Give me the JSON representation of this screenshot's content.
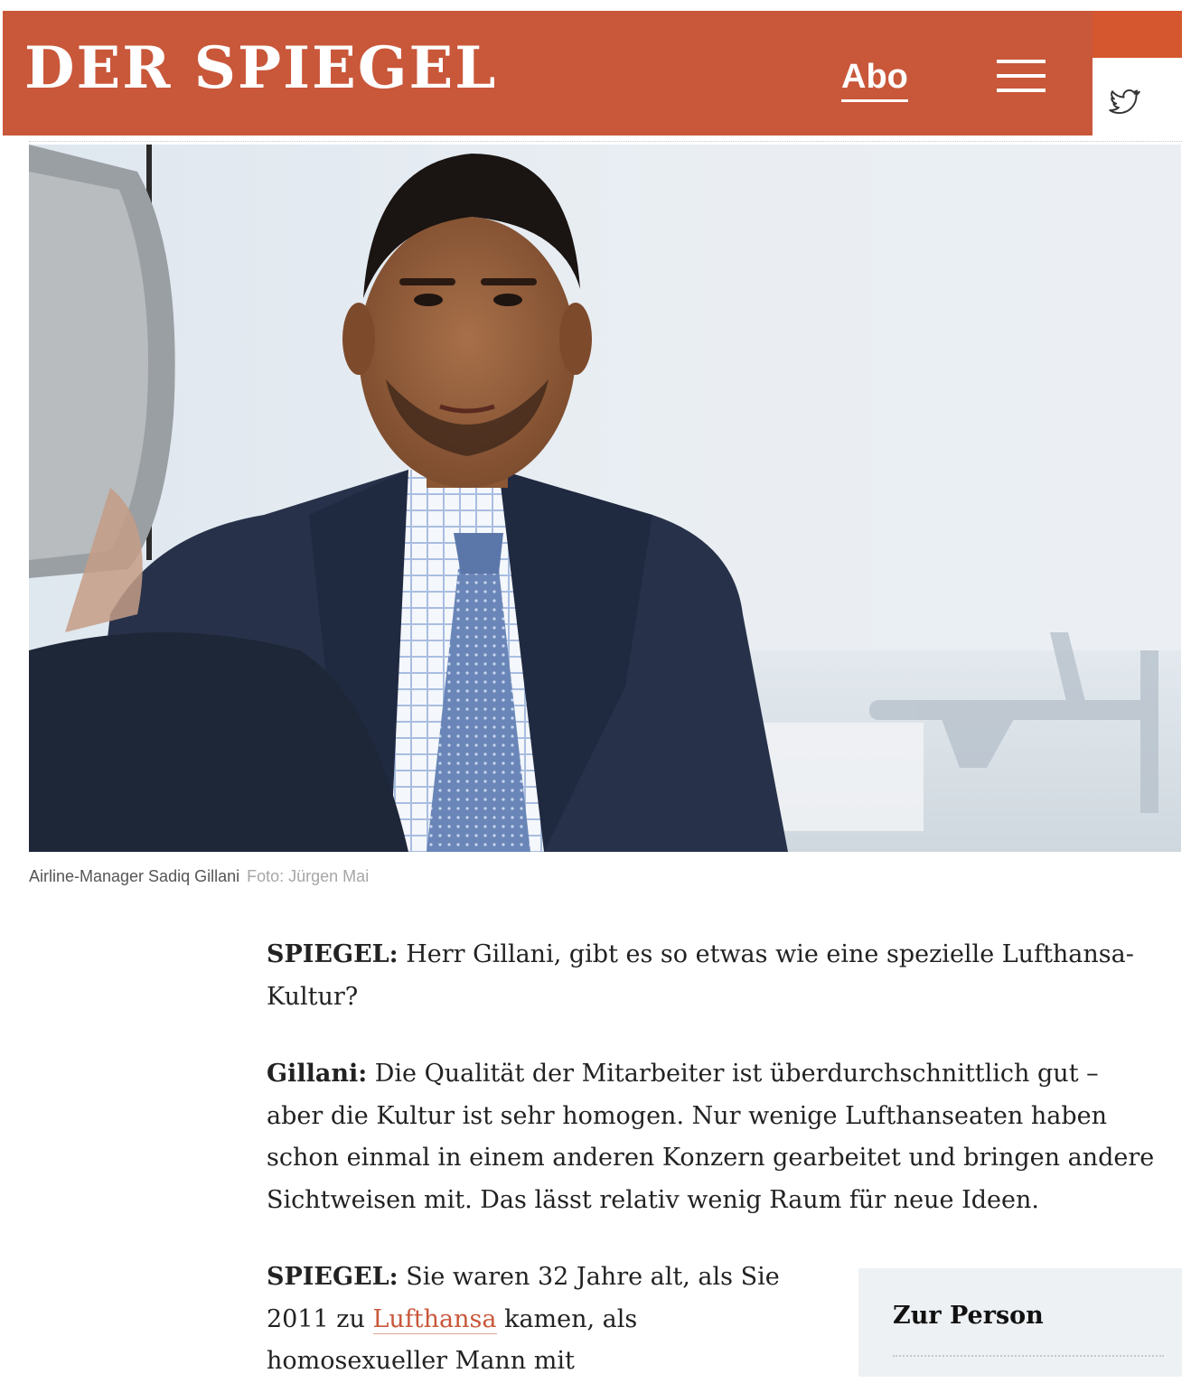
{
  "header": {
    "logo": "DER SPIEGEL",
    "abo_label": "Abo",
    "menu_icon": "hamburger-menu-icon",
    "share_icon": "twitter-icon",
    "brand_color": "#c9573a"
  },
  "hero": {
    "caption": "Airline-Manager Sadiq Gillani",
    "credit": "Foto: Jürgen Mai"
  },
  "article": {
    "q1": {
      "speaker": "SPIEGEL:",
      "line1": " Herr Gillani, gibt es so etwas wie eine spezielle Lufthansa-",
      "line2": "Kultur?"
    },
    "a1": {
      "speaker": "Gillani:",
      "line1": " Die Qualität der Mitarbeiter ist überdurchschnittlich gut –",
      "line2": "aber die Kultur ist sehr homogen. Nur wenige Lufthanseaten haben",
      "line3": "schon einmal in einem anderen Konzern gearbeitet und bringen andere",
      "line4": "Sichtweisen mit. Das lässt relativ wenig Raum für neue Ideen."
    },
    "q2": {
      "speaker": "SPIEGEL:",
      "line1": " Sie waren 32 Jahre alt, als Sie",
      "line2_pre": "2011 zu ",
      "line2_link": "Lufthansa",
      "line2_post": " kamen, als",
      "line3": "homosexueller Mann mit"
    }
  },
  "sidebar_box": {
    "title": "Zur Person"
  }
}
